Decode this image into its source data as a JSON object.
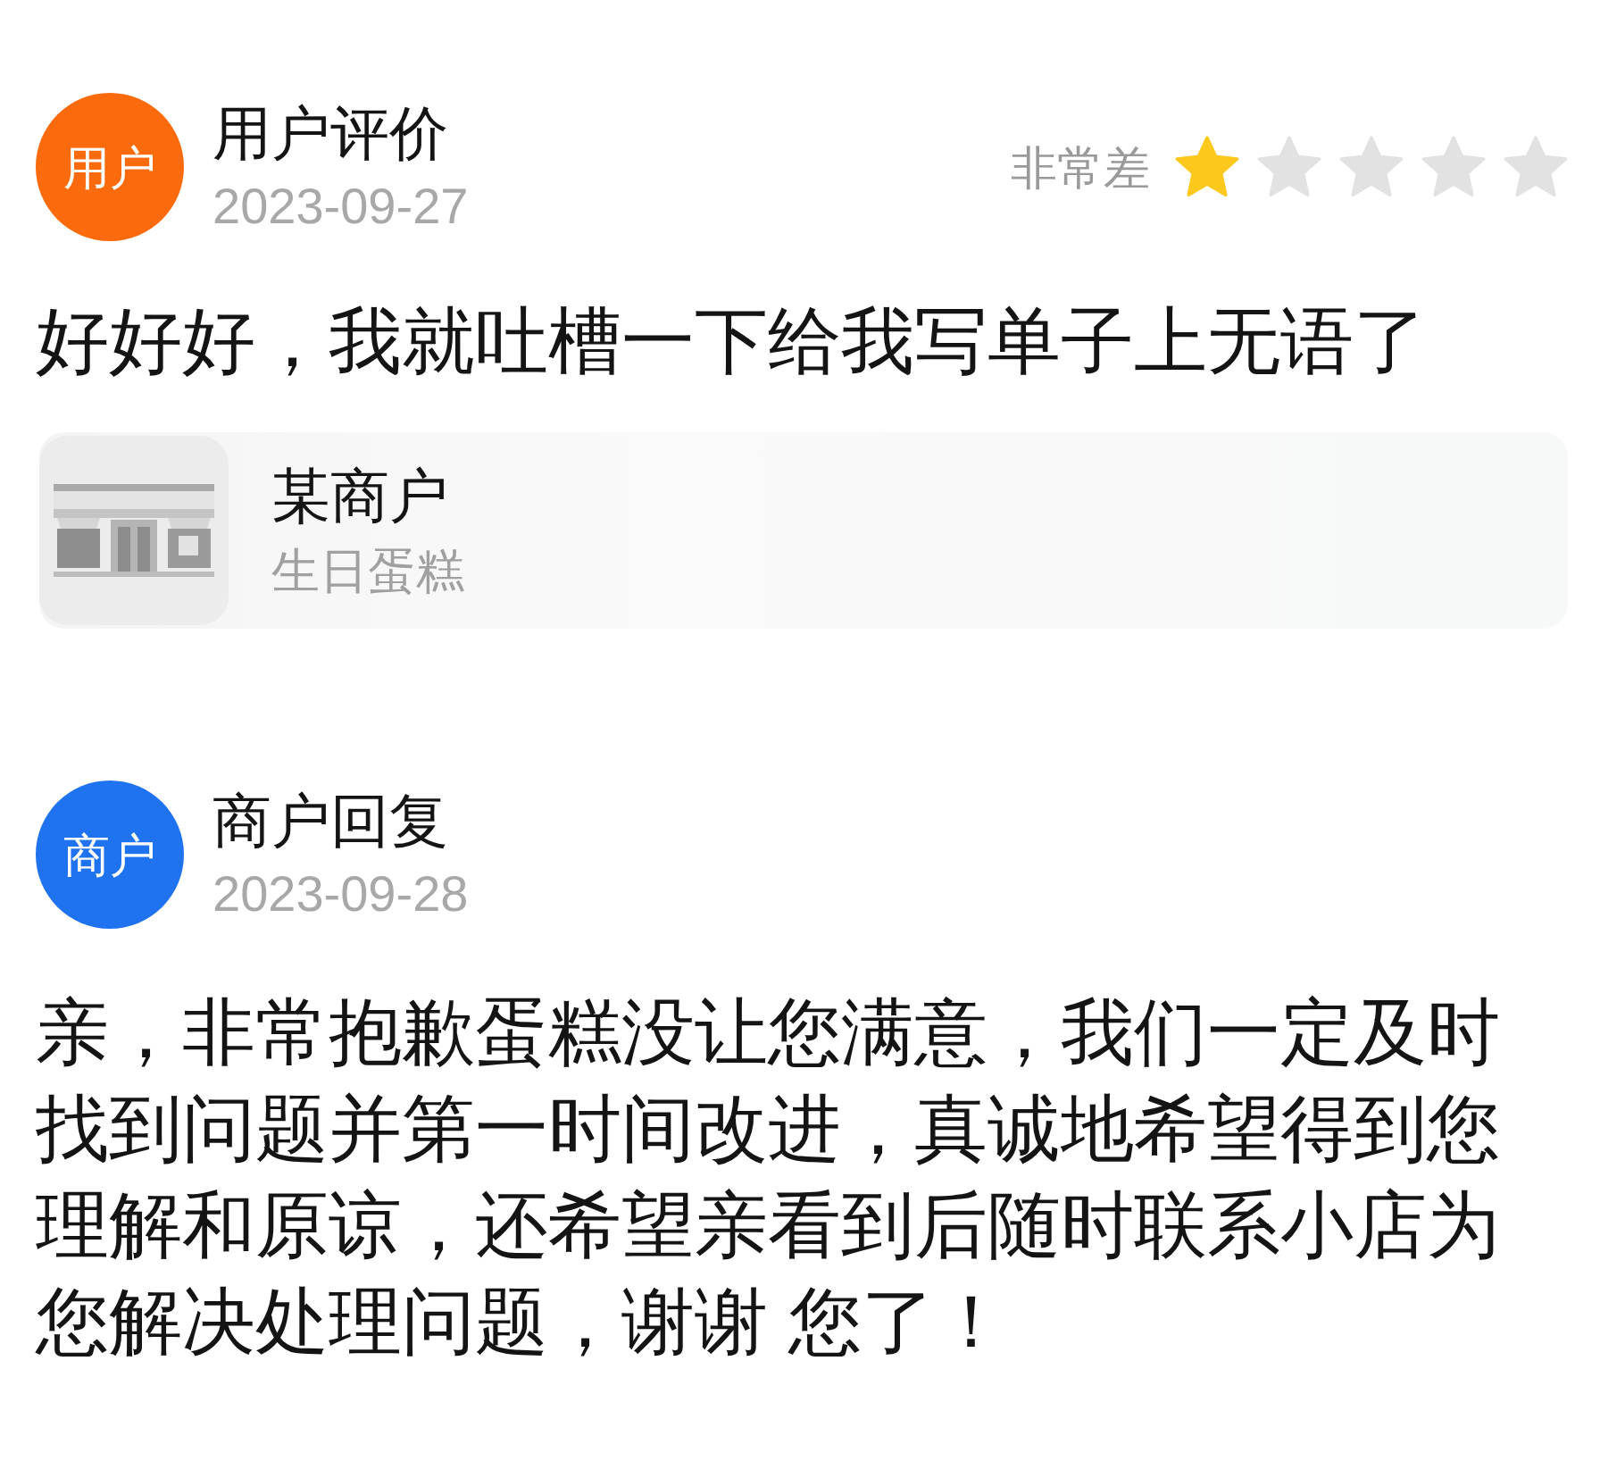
{
  "posts": [
    {
      "kind": "review",
      "avatar": {
        "label": "用户",
        "color": "#fb6a0c"
      },
      "title": "用户评价",
      "date": "2023-09-27",
      "rating": {
        "label": "非常差",
        "stars": 1
      },
      "text": "好好好，我就吐槽一下给我写单子上无语了",
      "shop": {
        "name": "某商户",
        "category": "生日蛋糕"
      }
    },
    {
      "kind": "reply",
      "avatar": {
        "label": "商户",
        "color": "#1f72f0"
      },
      "title": "商户回复",
      "date": "2023-09-28",
      "text": "亲，非常抱歉蛋糕没让您满意，我们一定及时找到问题并第一时间改进，真诚地希望得到您理解和原谅，还希望亲看到后随时联系小店为您解决处理问题，谢谢 您了！"
    }
  ]
}
